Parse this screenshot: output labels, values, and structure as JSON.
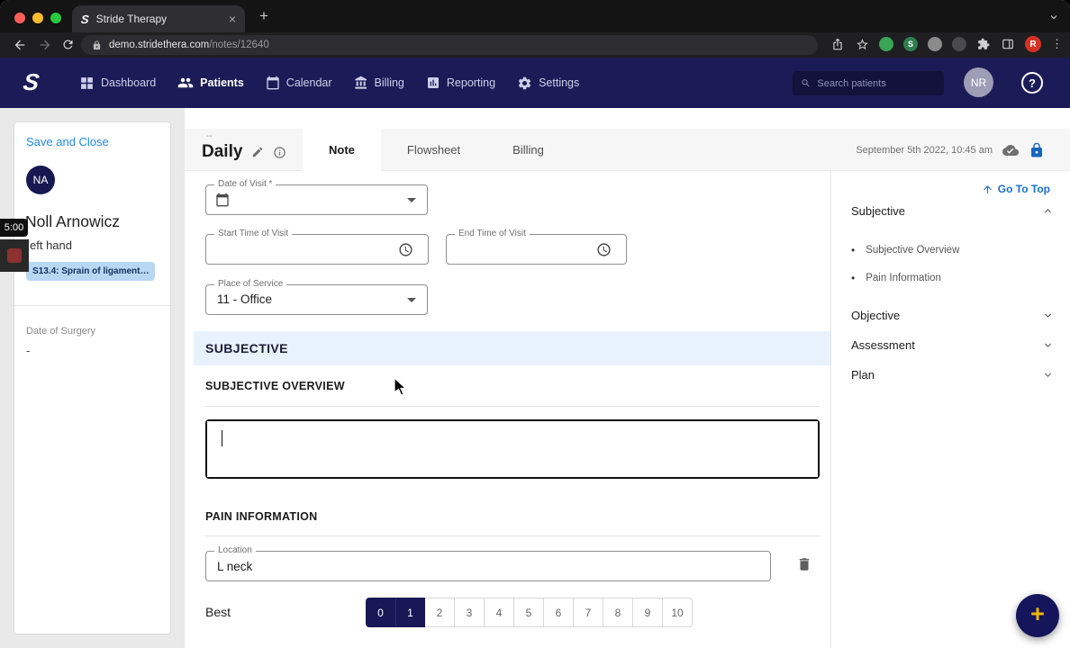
{
  "browser": {
    "tab_title": "Stride Therapy",
    "url_host": "demo.stridethera.com",
    "url_path": "/notes/12640",
    "profile_initial": "R"
  },
  "recorder": {
    "time": "5:00"
  },
  "app_header": {
    "brand_letter": "S",
    "nav": [
      "Dashboard",
      "Patients",
      "Calendar",
      "Billing",
      "Reporting",
      "Settings"
    ],
    "nav_active": "Patients",
    "search_placeholder": "Search patients",
    "user_initials": "NR",
    "help_glyph": "?"
  },
  "patient_panel": {
    "save_and_close": "Save and Close",
    "initials": "NA",
    "name": "Noll Arnowicz",
    "detail": "eft hand",
    "diagnosis_chip": "S13.4: Sprain of ligament…",
    "surgery_label": "Date of Surgery",
    "surgery_value": "-"
  },
  "note": {
    "supertitle": "--",
    "title": "Daily",
    "tabs": [
      "Note",
      "Flowsheet",
      "Billing"
    ],
    "active_tab": "Note",
    "timestamp": "September 5th 2022, 10:45 am"
  },
  "form": {
    "date_label": "Date of Visit *",
    "start_label": "Start Time of Visit",
    "end_label": "End Time of Visit",
    "place_label": "Place of Service",
    "place_value": "11 - Office",
    "section_title": "SUBJECTIVE",
    "overview_heading": "SUBJECTIVE OVERVIEW",
    "overview_value": "",
    "pain_heading": "PAIN INFORMATION",
    "location_label": "Location",
    "location_value": "L neck",
    "best_label": "Best",
    "pain_scale": [
      "0",
      "1",
      "2",
      "3",
      "4",
      "5",
      "6",
      "7",
      "8",
      "9",
      "10"
    ],
    "pain_scale_selected": [
      "0",
      "1"
    ]
  },
  "outline": {
    "go_to_top": "Go To Top",
    "sections": [
      {
        "label": "Subjective",
        "expanded": true,
        "items": [
          "Subjective Overview",
          "Pain Information"
        ]
      },
      {
        "label": "Objective",
        "expanded": false
      },
      {
        "label": "Assessment",
        "expanded": false
      },
      {
        "label": "Plan",
        "expanded": false
      }
    ]
  },
  "colors": {
    "brand_navy": "#1b1b57",
    "accent_blue": "#1e88e5",
    "lock_blue": "#1565c0",
    "chip_bg": "#b7d7f3",
    "section_bg": "#e8f2fc",
    "segment_selected": "#181857",
    "fab_bg": "#15155c",
    "fab_plus": "#f0b400"
  },
  "icons": {
    "close_tab": "×",
    "new_tab": "+",
    "kebab_menu": "⋮",
    "fab_plus": "+",
    "bullet": "•"
  }
}
